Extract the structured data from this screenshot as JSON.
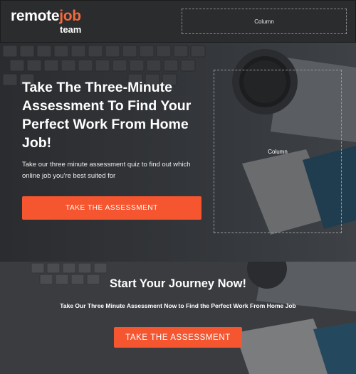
{
  "header": {
    "logo": {
      "word_main": "remote",
      "word_accent": "job",
      "word_sub": "team"
    },
    "column_placeholder": "Column"
  },
  "hero": {
    "title": "Take The Three-Minute Assessment To Find Your Perfect Work From Home Job!",
    "description": "Take our three minute assessment quiz to find out which online job you're best suited for",
    "button_label": "TAKE THE ASSESSMENT",
    "column_placeholder": "Column"
  },
  "journey": {
    "title": "Start Your Journey Now!",
    "subtitle": "Take Our Three Minute Assessment Now to Find the Perfect Work From Home Job",
    "button_label": "TAKE THE ASSESSMENT"
  },
  "colors": {
    "accent": "#f5552f",
    "logo_accent": "#f26a3d",
    "header_bg": "#2b2c2e",
    "text": "#ffffff"
  }
}
